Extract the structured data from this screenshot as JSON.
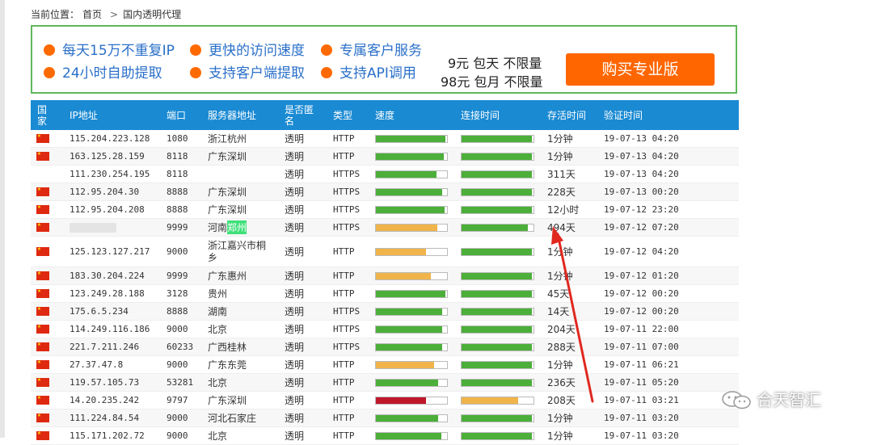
{
  "breadcrumb": {
    "label": "当前位置：",
    "home": "首页",
    "separator": ">",
    "current": "国内透明代理"
  },
  "promo": {
    "features": [
      "每天15万不重复IP",
      "更快的访问速度",
      "专属客户服务",
      "24小时自助提取",
      "支持客户端提取",
      "支持API调用"
    ],
    "prices": [
      "9元 包天 不限量",
      "98元 包月 不限量"
    ],
    "buy_label": "购买专业版",
    "dot_color": "#ff6600"
  },
  "table": {
    "headers": {
      "country": "国家",
      "ip": "IP地址",
      "port": "端口",
      "server": "服务器地址",
      "anon": "是否匿名",
      "type": "类型",
      "speed": "速度",
      "conn": "连接时间",
      "alive": "存活时间",
      "verify": "验证时间"
    },
    "rows": [
      {
        "flag": true,
        "ip": "115.204.223.128",
        "port": "1080",
        "server": "浙江杭州",
        "anon": "透明",
        "type": "HTTP",
        "speed": 0.98,
        "speed_color": "#4caf3a",
        "conn": 0.98,
        "conn_color": "#4caf3a",
        "alive": "1分钟",
        "verify": "19-07-13 04:20"
      },
      {
        "flag": true,
        "ip": "163.125.28.159",
        "port": "8118",
        "server": "广东深圳",
        "anon": "透明",
        "type": "HTTP",
        "speed": 0.95,
        "speed_color": "#4caf3a",
        "conn": 0.98,
        "conn_color": "#4caf3a",
        "alive": "1分钟",
        "verify": "19-07-13 04:20"
      },
      {
        "flag": false,
        "ip": "111.230.254.195",
        "port": "8118",
        "server": "",
        "anon": "透明",
        "type": "HTTPS",
        "speed": 0.85,
        "speed_color": "#4caf3a",
        "conn": 0.98,
        "conn_color": "#4caf3a",
        "alive": "311天",
        "verify": "19-07-13 04:20"
      },
      {
        "flag": true,
        "ip": "112.95.204.30",
        "port": "8888",
        "server": "广东深圳",
        "anon": "透明",
        "type": "HTTPS",
        "speed": 0.93,
        "speed_color": "#4caf3a",
        "conn": 0.98,
        "conn_color": "#4caf3a",
        "alive": "228天",
        "verify": "19-07-13 00:20"
      },
      {
        "flag": true,
        "ip": "112.95.204.208",
        "port": "8888",
        "server": "广东深圳",
        "anon": "透明",
        "type": "HTTPS",
        "speed": 0.97,
        "speed_color": "#4caf3a",
        "conn": 0.98,
        "conn_color": "#4caf3a",
        "alive": "12小时",
        "verify": "19-07-12 23:20"
      },
      {
        "flag": true,
        "ip": "",
        "port": "9999",
        "server": "河南",
        "server_hl": "郑州",
        "anon": "透明",
        "type": "HTTPS",
        "speed": 0.86,
        "speed_color": "#f0b44a",
        "conn": 0.92,
        "conn_color": "#4caf3a",
        "alive": "494天",
        "verify": "19-07-12 07:20"
      },
      {
        "flag": true,
        "ip": "125.123.127.217",
        "port": "9000",
        "server": "浙江嘉兴市桐乡",
        "anon": "透明",
        "type": "HTTP",
        "speed": 0.7,
        "speed_color": "#f0b44a",
        "conn": 0.98,
        "conn_color": "#4caf3a",
        "alive": "1分钟",
        "verify": "19-07-12 04:20"
      },
      {
        "flag": true,
        "ip": "183.30.204.224",
        "port": "9999",
        "server": "广东惠州",
        "anon": "透明",
        "type": "HTTP",
        "speed": 0.77,
        "speed_color": "#f0b44a",
        "conn": 0.98,
        "conn_color": "#4caf3a",
        "alive": "1分钟",
        "verify": "19-07-12 01:20"
      },
      {
        "flag": true,
        "ip": "123.249.28.188",
        "port": "3128",
        "server": "贵州",
        "anon": "透明",
        "type": "HTTP",
        "speed": 0.98,
        "speed_color": "#4caf3a",
        "conn": 0.98,
        "conn_color": "#4caf3a",
        "alive": "45天",
        "verify": "19-07-12 00:20"
      },
      {
        "flag": true,
        "ip": "175.6.5.234",
        "port": "8888",
        "server": "湖南",
        "anon": "透明",
        "type": "HTTPS",
        "speed": 0.93,
        "speed_color": "#4caf3a",
        "conn": 0.98,
        "conn_color": "#4caf3a",
        "alive": "14天",
        "verify": "19-07-12 00:20"
      },
      {
        "flag": true,
        "ip": "114.249.116.186",
        "port": "9000",
        "server": "北京",
        "anon": "透明",
        "type": "HTTPS",
        "speed": 0.93,
        "speed_color": "#4caf3a",
        "conn": 0.98,
        "conn_color": "#4caf3a",
        "alive": "204天",
        "verify": "19-07-11 22:00"
      },
      {
        "flag": true,
        "ip": "221.7.211.246",
        "port": "60233",
        "server": "广西桂林",
        "anon": "透明",
        "type": "HTTPS",
        "speed": 0.93,
        "speed_color": "#4caf3a",
        "conn": 0.98,
        "conn_color": "#4caf3a",
        "alive": "288天",
        "verify": "19-07-11 07:00"
      },
      {
        "flag": true,
        "ip": "27.37.47.8",
        "port": "9000",
        "server": "广东东莞",
        "anon": "透明",
        "type": "HTTP",
        "speed": 0.82,
        "speed_color": "#f0b44a",
        "conn": 0.98,
        "conn_color": "#4caf3a",
        "alive": "1分钟",
        "verify": "19-07-11 06:21"
      },
      {
        "flag": true,
        "ip": "119.57.105.73",
        "port": "53281",
        "server": "北京",
        "anon": "透明",
        "type": "HTTP",
        "speed": 0.87,
        "speed_color": "#4caf3a",
        "conn": 0.98,
        "conn_color": "#4caf3a",
        "alive": "236天",
        "verify": "19-07-11 05:20"
      },
      {
        "flag": true,
        "ip": "14.20.235.242",
        "port": "9797",
        "server": "广东深圳",
        "anon": "透明",
        "type": "HTTP",
        "speed": 0.71,
        "speed_color": "#c0172b",
        "conn": 0.79,
        "conn_color": "#f0b44a",
        "alive": "208天",
        "verify": "19-07-11 03:21"
      },
      {
        "flag": true,
        "ip": "111.224.84.54",
        "port": "9000",
        "server": "河北石家庄",
        "anon": "透明",
        "type": "HTTP",
        "speed": 0.88,
        "speed_color": "#4caf3a",
        "conn": 0.98,
        "conn_color": "#4caf3a",
        "alive": "1分钟",
        "verify": "19-07-11 03:20"
      },
      {
        "flag": true,
        "ip": "115.171.202.72",
        "port": "9000",
        "server": "北京",
        "anon": "透明",
        "type": "HTTP",
        "speed": 0.92,
        "speed_color": "#4caf3a",
        "conn": 0.98,
        "conn_color": "#4caf3a",
        "alive": "1分钟",
        "verify": "19-07-11 03:20"
      }
    ]
  },
  "watermark": {
    "text": "合天智汇",
    "icon": "wechat-icon"
  },
  "annotation": {
    "icon": "red-arrow-icon",
    "color": "#e0281f"
  }
}
